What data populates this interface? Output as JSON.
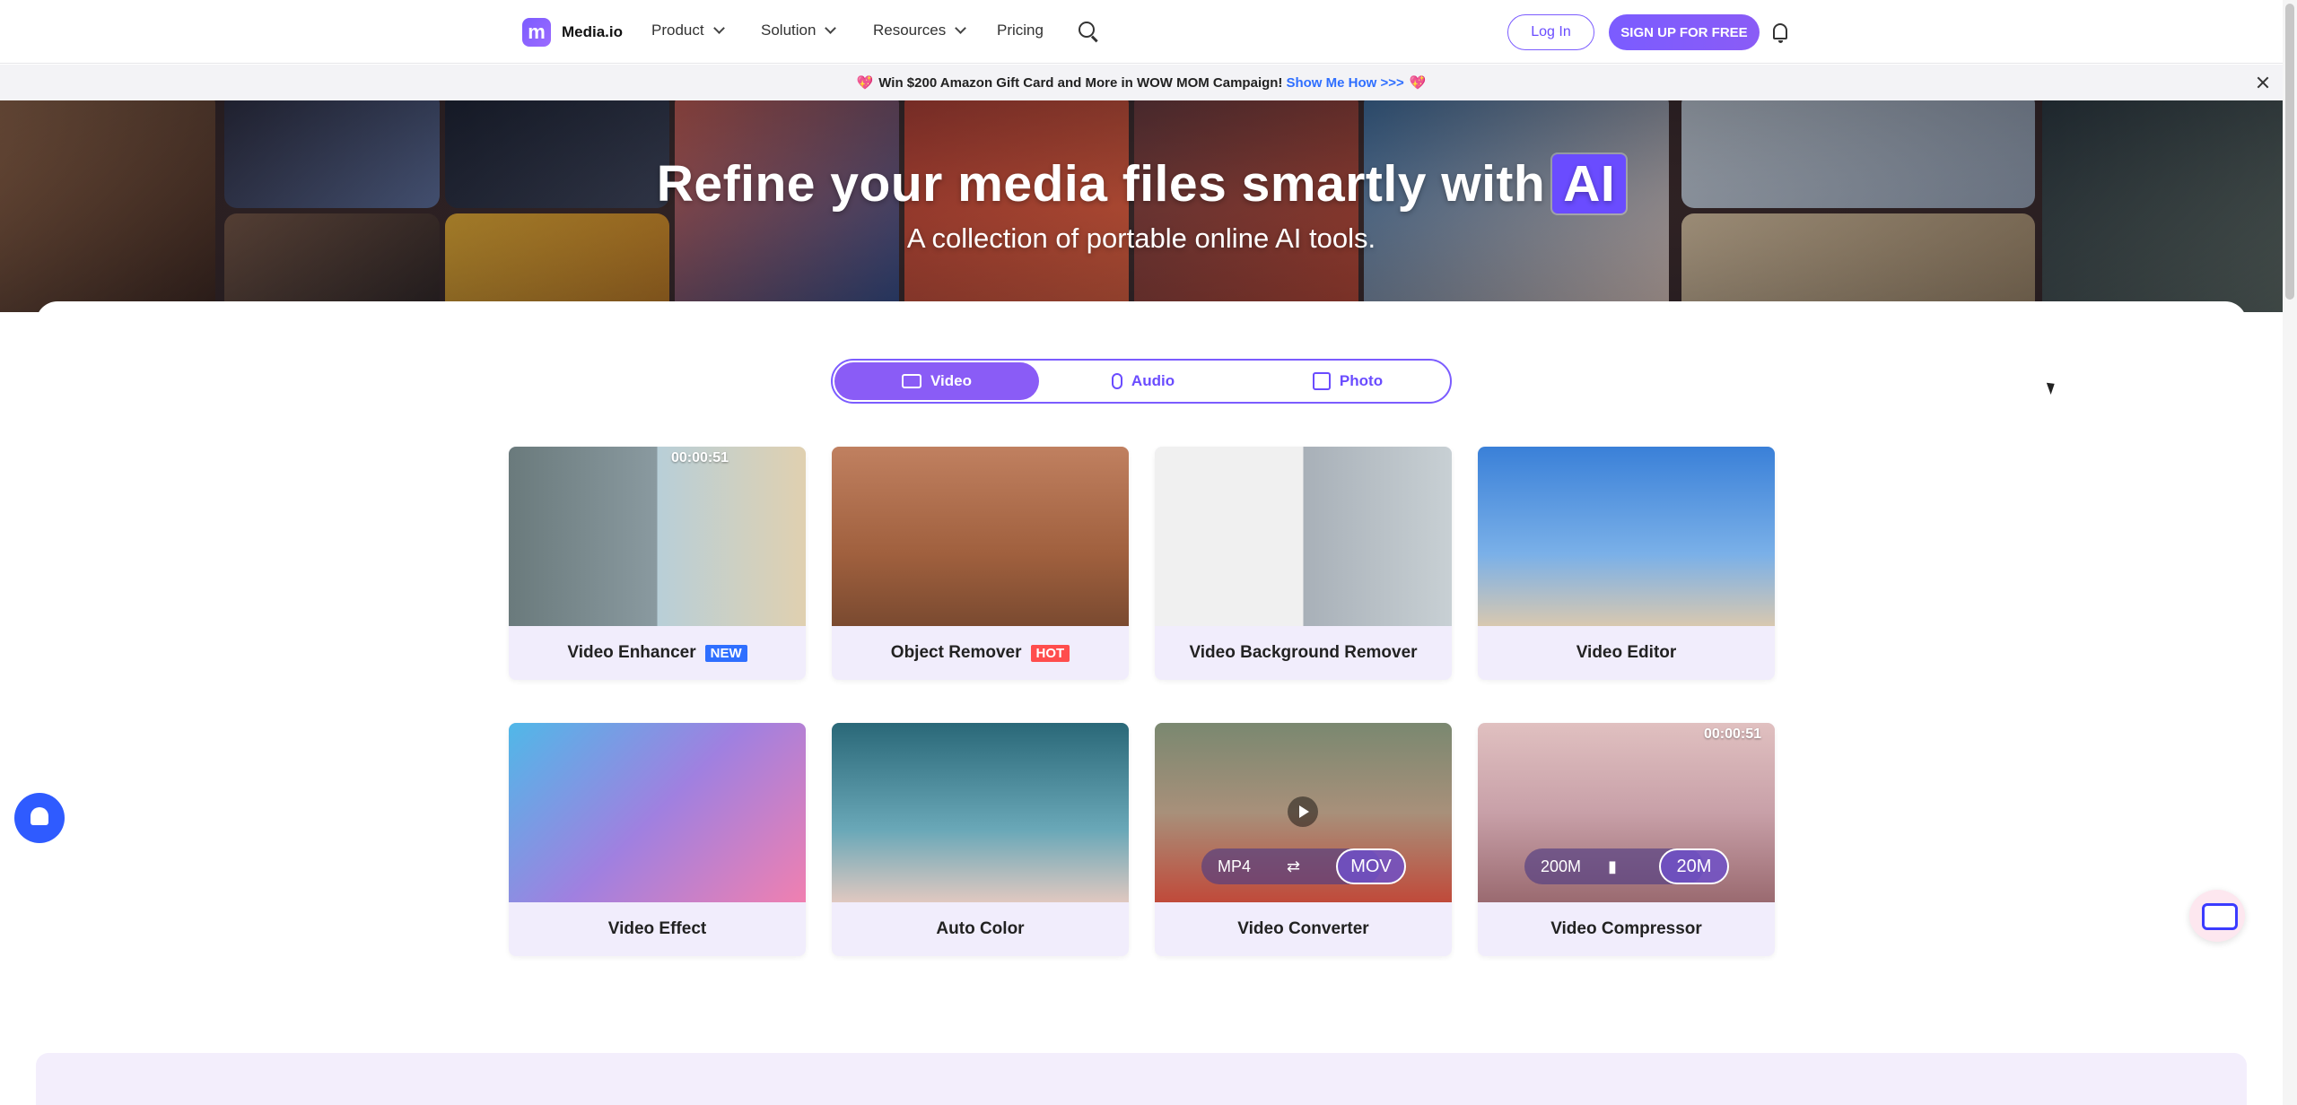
{
  "nav": {
    "logo_letter": "m",
    "logo_text": "Media.io",
    "items": [
      {
        "label": "Product",
        "has_dropdown": true
      },
      {
        "label": "Solution",
        "has_dropdown": true
      },
      {
        "label": "Resources",
        "has_dropdown": true
      },
      {
        "label": "Pricing",
        "has_dropdown": false
      }
    ],
    "login_label": "Log In",
    "signup_label": "SIGN UP FOR FREE"
  },
  "promo": {
    "text": "Win $200 Amazon Gift Card and More in WOW MOM Campaign!",
    "link": "Show Me How >>>",
    "heart": "💖"
  },
  "hero": {
    "title": "Refine your media files smartly with",
    "title_badge": "AI",
    "subtitle": "A collection of portable online AI tools."
  },
  "tabs": [
    {
      "label": "Video",
      "icon": "video-icon",
      "active": true
    },
    {
      "label": "Audio",
      "icon": "microphone-icon",
      "active": false
    },
    {
      "label": "Photo",
      "icon": "image-icon",
      "active": false
    }
  ],
  "cards": [
    {
      "label": "Video Enhancer",
      "badge": "NEW",
      "overlay_time": "00:00:51"
    },
    {
      "label": "Object Remover",
      "badge": "HOT"
    },
    {
      "label": "Video Background Remover"
    },
    {
      "label": "Video Editor"
    },
    {
      "label": "Video Effect"
    },
    {
      "label": "Auto Color"
    },
    {
      "label": "Video Converter",
      "from": "MP4",
      "to": "MOV"
    },
    {
      "label": "Video Compressor",
      "overlay_time": "00:00:51",
      "from": "200M",
      "to": "20M"
    }
  ],
  "colors": {
    "accent": "#7b5cff",
    "link": "#2f6fff",
    "hot": "#ff4d4d",
    "new": "#2f6fff"
  }
}
